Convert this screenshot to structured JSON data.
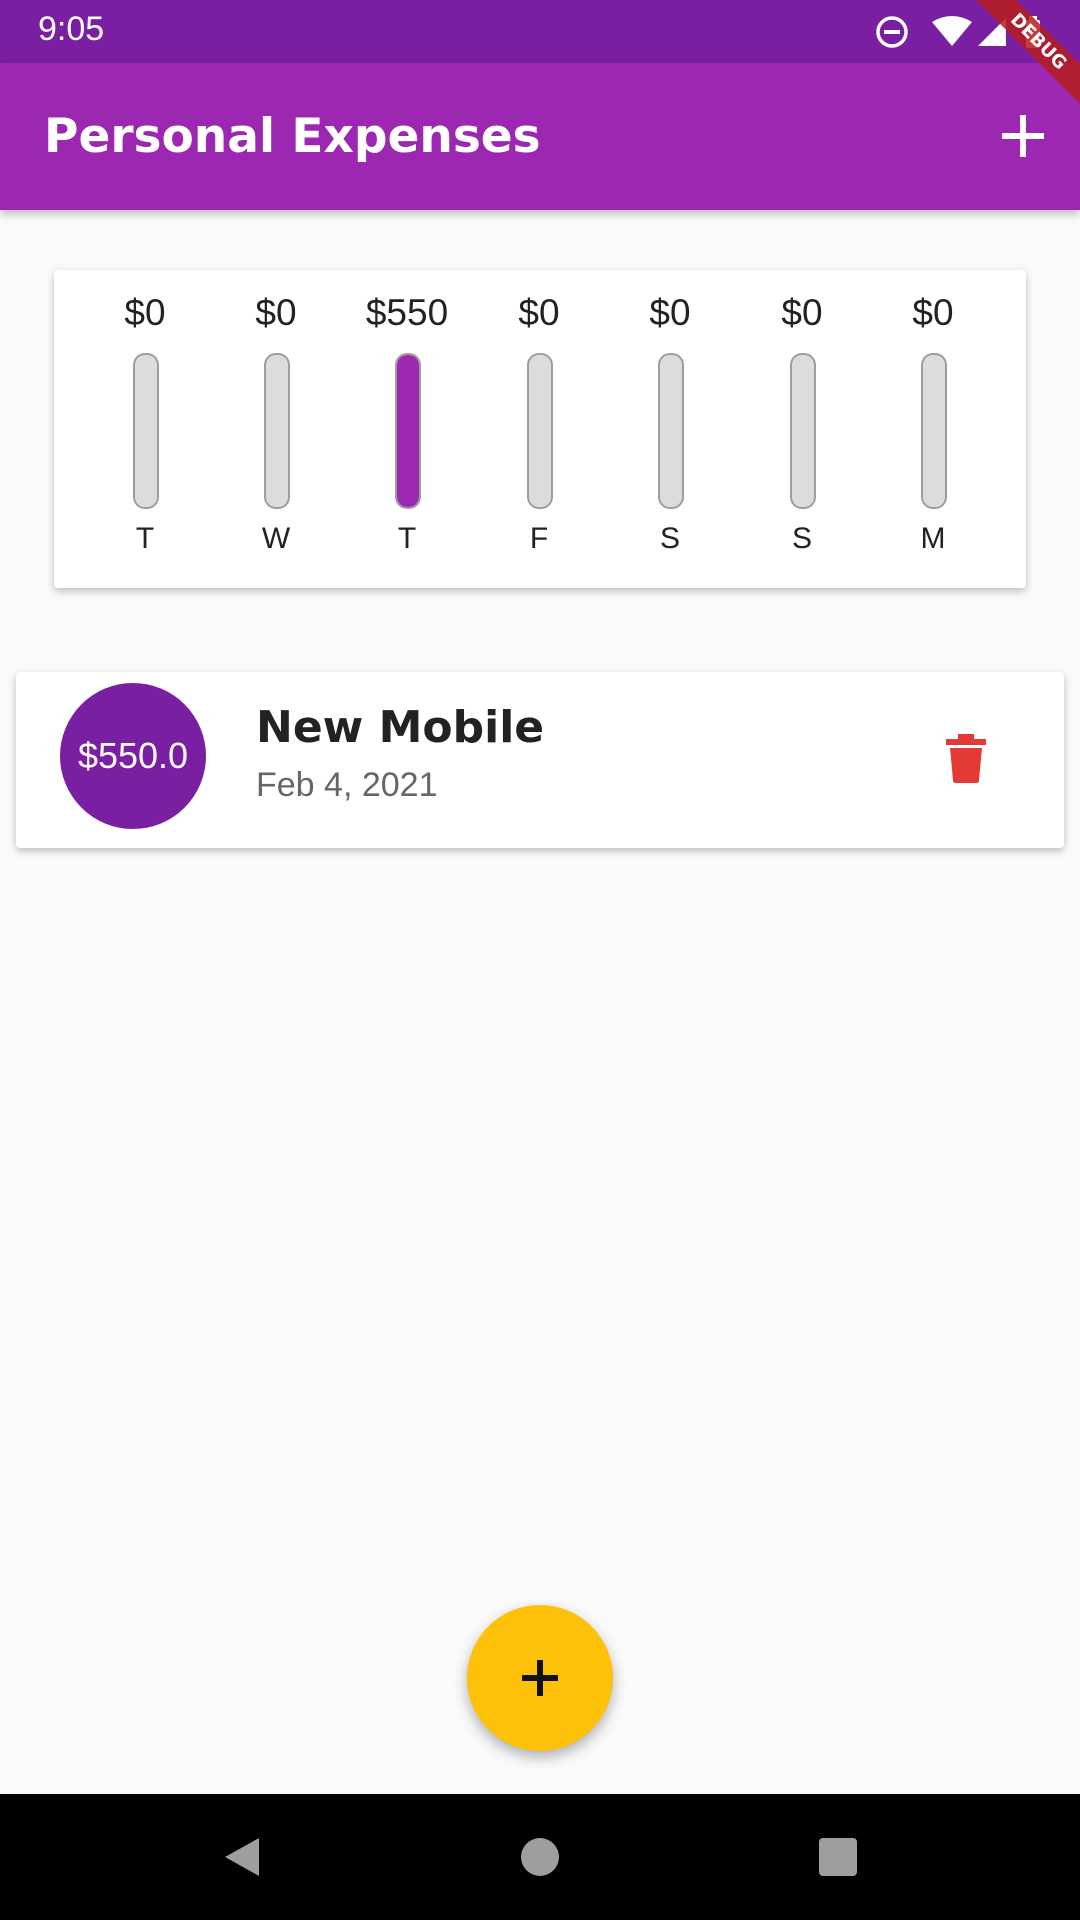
{
  "status_bar": {
    "time": "9:05",
    "icons": [
      "do-not-disturb-icon",
      "wifi-icon",
      "signal-icon",
      "battery-icon"
    ]
  },
  "debug_banner": "DEBUG",
  "app_bar": {
    "title": "Personal Expenses",
    "action_icon": "add-icon",
    "color": "#9c27b0"
  },
  "chart": {
    "accent": "#9c27b0",
    "bars": [
      {
        "amount": "$0",
        "day": "T",
        "fraction": 0
      },
      {
        "amount": "$0",
        "day": "W",
        "fraction": 0
      },
      {
        "amount": "$550",
        "day": "T",
        "fraction": 1
      },
      {
        "amount": "$0",
        "day": "F",
        "fraction": 0
      },
      {
        "amount": "$0",
        "day": "S",
        "fraction": 0
      },
      {
        "amount": "$0",
        "day": "S",
        "fraction": 0
      },
      {
        "amount": "$0",
        "day": "M",
        "fraction": 0
      }
    ]
  },
  "transactions": [
    {
      "amount": "$550.0",
      "title": "New Mobile",
      "date": "Feb 4, 2021",
      "delete_icon": "trash-icon"
    }
  ],
  "fab": {
    "icon": "add-icon",
    "color": "#fdc10a"
  },
  "nav_bar": {
    "icons": [
      "back-icon",
      "home-icon",
      "recents-icon"
    ]
  }
}
